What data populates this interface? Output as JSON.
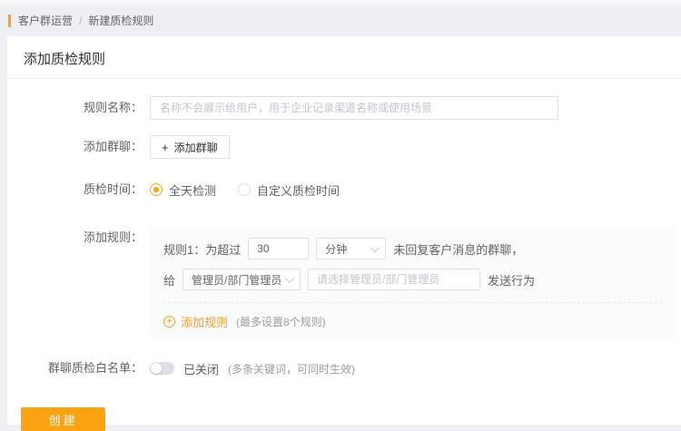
{
  "breadcrumb": {
    "section": "客户群运营",
    "separator": "/",
    "current": "新建质检规则"
  },
  "page": {
    "title": "添加质检规则"
  },
  "form": {
    "rule_name": {
      "label": "规则名称：",
      "value": "",
      "placeholder": "名称不会展示给用户，用于企业记录渠道名称或使用场景"
    },
    "add_group_chat": {
      "label": "添加群聊：",
      "plus_icon": "+",
      "button_label": "添加群聊"
    },
    "inspection_time": {
      "label": "质检时间：",
      "options": [
        {
          "label": "全天检测",
          "selected": true
        },
        {
          "label": "自定义质检时间",
          "selected": false
        }
      ]
    },
    "add_rules": {
      "label": "添加规则：",
      "rule_row": {
        "prefix": "规则1：为超过",
        "threshold_value": "30",
        "unit_selected": "分钟",
        "suffix": "未回复客户消息的群聊，"
      },
      "notify_row": {
        "prefix": "给",
        "recipient_selected": "管理员/部门管理员",
        "recipient_placeholder": "请选择管理员/部门管理员",
        "suffix": "发送行为"
      },
      "add_rule_link": {
        "icon": "plus-circle",
        "icon_glyph": "+",
        "label": "添加规则",
        "note": "(最多设置8个规则)"
      }
    },
    "whitelist": {
      "label": "群聊质检白名单：",
      "enabled": false,
      "state_label": "已关闭",
      "note": "(多条关键词，可同时生效)"
    }
  },
  "footer": {
    "create_button": "创建"
  },
  "colors": {
    "accent_orange": "#FBA311",
    "link_orange": "#F59A23",
    "page_bg": "#EDEFF2",
    "panel_bg": "#FFFFFF",
    "rules_panel_bg": "#FAFBFC",
    "border": "#DCDFE6",
    "text_primary": "#303133",
    "text_secondary": "#606266",
    "text_muted": "#9A9CA1",
    "placeholder": "#BFC4CC"
  }
}
